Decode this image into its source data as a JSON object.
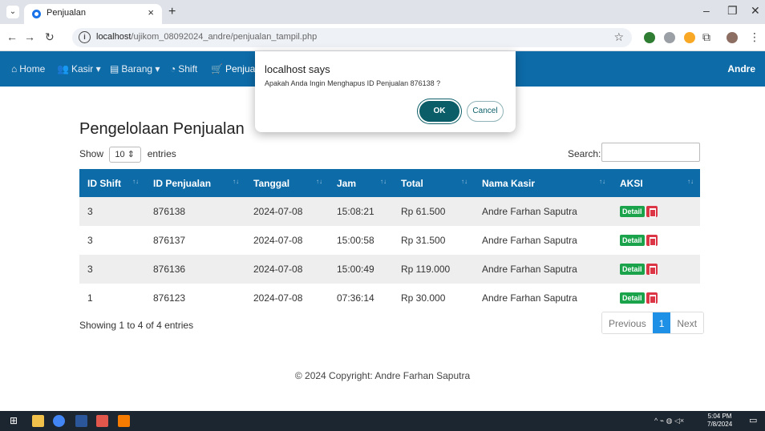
{
  "browser": {
    "tab_title": "Penjualan",
    "url_host": "localhost",
    "url_path": "/ujikom_08092024_andre/penjualan_tampil.php"
  },
  "navbar": {
    "items": [
      {
        "label": "Home",
        "icon": "home-icon"
      },
      {
        "label": "Kasir",
        "icon": "users-icon",
        "dropdown": true
      },
      {
        "label": "Barang",
        "icon": "box-icon",
        "dropdown": true
      },
      {
        "label": "Shift",
        "icon": "clock-icon"
      },
      {
        "label": "Penjuala",
        "icon": "cart-icon"
      }
    ],
    "user": "Andre"
  },
  "dialog": {
    "title": "localhost says",
    "message": "Apakah Anda Ingin Menghapus ID Penjualan 876138 ?",
    "ok_label": "OK",
    "cancel_label": "Cancel"
  },
  "page": {
    "title": "Pengelolaan Penjualan",
    "show_label": "Show",
    "entries_value": "10",
    "entries_label": "entries",
    "search_label": "Search:",
    "search_value": ""
  },
  "table": {
    "columns": [
      "ID Shift",
      "ID Penjualan",
      "Tanggal",
      "Jam",
      "Total",
      "Nama Kasir",
      "AKSI"
    ],
    "rows": [
      {
        "id_shift": "3",
        "id_penjualan": "876138",
        "tanggal": "2024-07-08",
        "jam": "15:08:21",
        "total": "Rp 61.500",
        "kasir": "Andre Farhan Saputra"
      },
      {
        "id_shift": "3",
        "id_penjualan": "876137",
        "tanggal": "2024-07-08",
        "jam": "15:00:58",
        "total": "Rp 31.500",
        "kasir": "Andre Farhan Saputra"
      },
      {
        "id_shift": "3",
        "id_penjualan": "876136",
        "tanggal": "2024-07-08",
        "jam": "15:00:49",
        "total": "Rp 119.000",
        "kasir": "Andre Farhan Saputra"
      },
      {
        "id_shift": "1",
        "id_penjualan": "876123",
        "tanggal": "2024-07-08",
        "jam": "07:36:14",
        "total": "Rp 30.000",
        "kasir": "Andre Farhan Saputra"
      }
    ],
    "detail_label": "Detail"
  },
  "pagination": {
    "info": "Showing 1 to 4 of 4 entries",
    "previous": "Previous",
    "current": "1",
    "next": "Next"
  },
  "footer": "© 2024 Copyright: Andre Farhan Saputra",
  "taskbar": {
    "time": "5:04 PM",
    "date": "7/8/2024"
  },
  "colors": {
    "navbar": "#0d6ba8",
    "dialog_ok": "#0b5e68",
    "detail_button": "#1aa34a",
    "delete_button": "#dc3545",
    "pager_active": "#1e90e6"
  }
}
